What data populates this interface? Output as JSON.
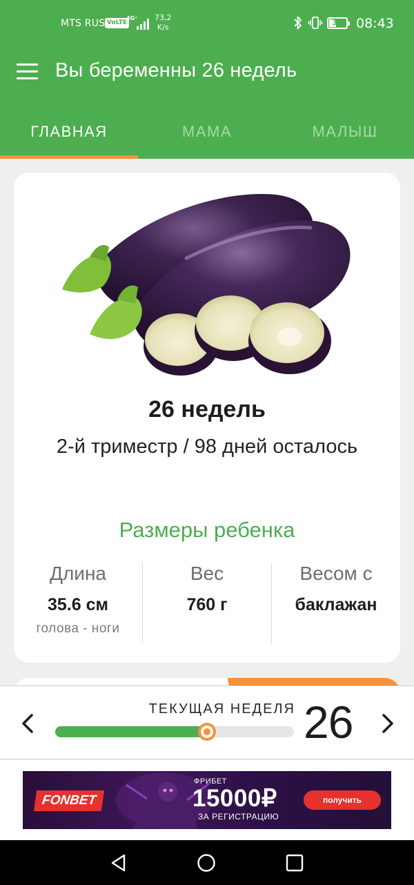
{
  "status_bar": {
    "carrier": "MTS RUS",
    "volte": "VoLTE",
    "network": "4G⁺",
    "speed_value": "73,2",
    "speed_unit": "K/s",
    "battery": "39",
    "time": "08:43"
  },
  "toolbar": {
    "title": "Вы беременны 26 недель",
    "menu_icon": "hamburger-menu-icon"
  },
  "tabs": [
    {
      "label": "ГЛАВНАЯ",
      "active": true
    },
    {
      "label": "МАМА",
      "active": false
    },
    {
      "label": "МАЛЫШ",
      "active": false
    }
  ],
  "week_card": {
    "image": "eggplant-illustration",
    "title": "26 недель",
    "trimester": "2-й триместр / 98 дней осталось",
    "sizes_title": "Размеры ребенка",
    "stats": [
      {
        "label": "Длина",
        "value": "35.6 см",
        "sub": "голова - ноги"
      },
      {
        "label": "Вес",
        "value": "760 г",
        "sub": ""
      },
      {
        "label": "Весом с",
        "value": "баклажан",
        "sub": ""
      }
    ]
  },
  "week_selector": {
    "label": "ТЕКУЩАЯ НЕДЕЛЯ",
    "week": "26",
    "progress": 0.635,
    "prev_icon": "chevron-left-icon",
    "next_icon": "chevron-right-icon"
  },
  "ad": {
    "brand": "FONBET",
    "pre": "ФРИБЕТ",
    "amount": "15000₽",
    "sub": "ЗА РЕГИСТРАЦИЮ",
    "cta": "получить"
  },
  "system_nav": {
    "back_icon": "back-triangle-icon",
    "home_icon": "home-circle-icon",
    "recent_icon": "recent-square-icon"
  },
  "colors": {
    "primary": "#4cae4f",
    "accent": "#f7913c",
    "tab_inactive": "#a7dba9",
    "ad_red": "#e5322c"
  }
}
